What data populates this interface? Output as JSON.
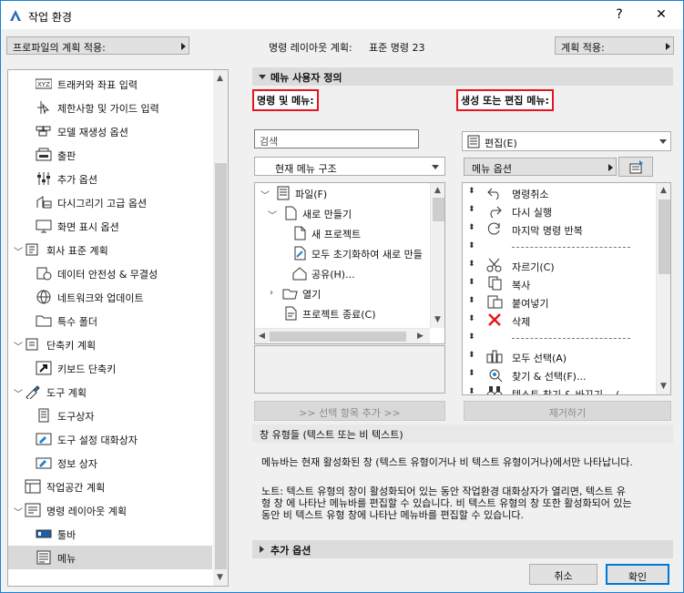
{
  "window": {
    "title": "작업 환경",
    "help_label": "?",
    "close_label": "✕"
  },
  "top_bar": {
    "apply_profile_label": "프로파일의 계획 적용:",
    "command_layout_prefix": "명령 레이아웃 계획:",
    "command_layout_value": "표준 명령 23",
    "apply_scheme_label": "계획 적용:"
  },
  "sidebar": {
    "items": [
      {
        "label": "트래커와 좌표 입력",
        "icon": "xyz-icon"
      },
      {
        "label": "제한사항 및 가이드 입력",
        "icon": "cursor-guide-icon"
      },
      {
        "label": "모델 재생성 옵션",
        "icon": "bricks-icon"
      },
      {
        "label": "출판",
        "icon": "publish-icon"
      },
      {
        "label": "추가 옵션",
        "icon": "sliders-icon"
      },
      {
        "label": "다시그리기 고급 옵션",
        "icon": "redraw-icon"
      },
      {
        "label": "화면 표시 옵션",
        "icon": "monitor-icon"
      },
      {
        "label": "회사 표준 계획",
        "icon": "company-scheme-icon"
      },
      {
        "label": "데이터 안전성 & 무결성",
        "icon": "data-safety-icon"
      },
      {
        "label": "네트워크와 업데이트",
        "icon": "globe-icon"
      },
      {
        "label": "특수 폴더",
        "icon": "folder-icon"
      },
      {
        "label": "단축키 계획",
        "icon": "shortcut-scheme-icon"
      },
      {
        "label": "키보드 단축키",
        "icon": "keyboard-arrow-icon"
      },
      {
        "label": "도구 계획",
        "icon": "tool-scheme-icon"
      },
      {
        "label": "도구상자",
        "icon": "toolbox-icon"
      },
      {
        "label": "도구 설정 대화상자",
        "icon": "tool-settings-icon"
      },
      {
        "label": "정보 상자",
        "icon": "info-box-icon"
      },
      {
        "label": "작업공간 계획",
        "icon": "workspace-icon"
      },
      {
        "label": "명령 레이아웃 계획",
        "icon": "command-layout-icon"
      },
      {
        "label": "툴바",
        "icon": "toolbar-icon"
      },
      {
        "label": "메뉴",
        "icon": "menu-icon"
      }
    ]
  },
  "main": {
    "section_title": "메뉴 사용자 정의",
    "commands_label": "명령 및 메뉴:",
    "edit_menus_label": "생성 또는 편집 메뉴:",
    "search_placeholder": "검색",
    "structure_combo": "현재 메뉴 구조",
    "left_tree": [
      {
        "label": "파일(F)",
        "icon": "file-menu-icon"
      },
      {
        "label": "새로 만들기",
        "icon": "new-document-icon"
      },
      {
        "label": "새 프로젝트",
        "icon": "new-project-icon"
      },
      {
        "label": "모두 초기화하여 새로 만들",
        "icon": "reset-new-icon"
      },
      {
        "label": "공유(H)...",
        "icon": "share-house-icon"
      },
      {
        "label": "열기",
        "icon": "open-folder-icon"
      },
      {
        "label": "프로젝트 종료(C)",
        "icon": "close-project-icon"
      }
    ],
    "add_selection_button": ">> 선택 항목 추가 >>",
    "edit_combo": "편집(E)",
    "menu_options_label": "메뉴 옵션",
    "right_list": [
      {
        "label": "명령취소",
        "icon": "undo-icon"
      },
      {
        "label": "다시 실행",
        "icon": "redo-icon"
      },
      {
        "label": "마지막 명령 반복",
        "icon": "repeat-icon"
      },
      {
        "label": "",
        "separator": true
      },
      {
        "label": "자르기(C)",
        "icon": "scissors-icon"
      },
      {
        "label": "복사",
        "icon": "copy-icon"
      },
      {
        "label": "붙여넣기",
        "icon": "paste-icon"
      },
      {
        "label": "삭제",
        "icon": "delete-x-icon"
      },
      {
        "label": "",
        "separator": true
      },
      {
        "label": "모두 선택(A)",
        "icon": "select-all-icon"
      },
      {
        "label": "찾기 & 선택(F)...",
        "icon": "find-select-icon"
      },
      {
        "label": "텍스트 찾기 & 바꾸기... (",
        "icon": "binoculars-icon"
      }
    ],
    "remove_button": "제거하기",
    "info_title": "창 유형들 (텍스트 또는 비 텍스트)",
    "info_p1": "메뉴바는 현재 활성화된 창 (텍스트 유형이거나 비 텍스트 유형이거나)에서만 나타납니다.",
    "info_p2_l1": "노트: 텍스트 유형의 창이 활성화되어 있는 동안 작업환경 대화상자가 열리면, 텍스트 유",
    "info_p2_l2": "형 창 에 나타난 메뉴바를 편집할 수 있습니다. 비 텍스트 유형의 창 또한 활성화되어 있는",
    "info_p2_l3": "동안 비 텍스트 유형 창에 나타난 메뉴바를 편집할 수 있습니다.",
    "extra_options": "추가 옵션"
  },
  "footer": {
    "cancel_label": "취소",
    "ok_label": "확인"
  },
  "colors": {
    "accent": "#1883d7",
    "highlight": "#e8141c",
    "selection": "#cce4f7"
  }
}
